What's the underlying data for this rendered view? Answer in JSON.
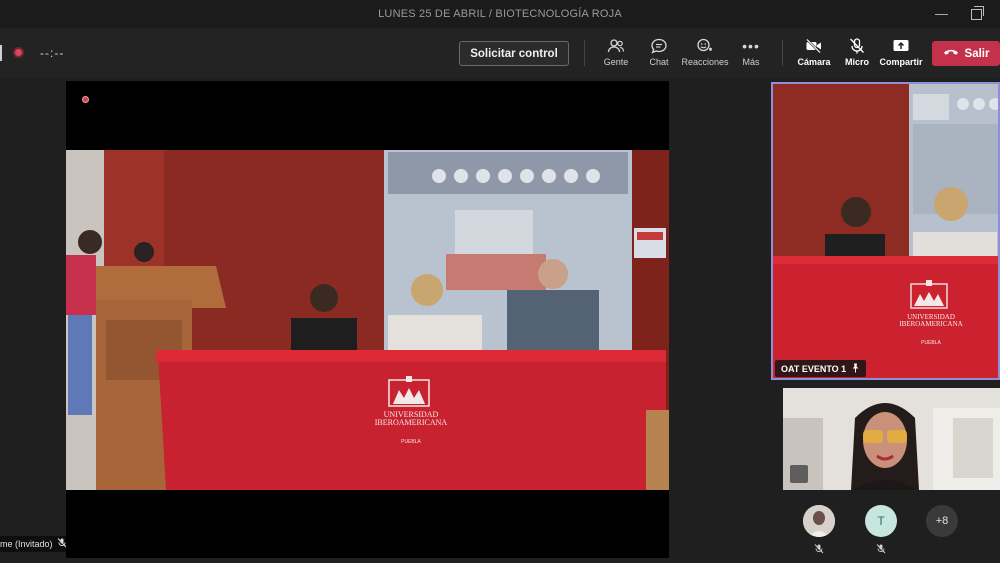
{
  "window": {
    "title": "LUNES 25 DE ABRIL / BIOTECNOLOGÍA ROJA"
  },
  "toolbar": {
    "timer": "--:--",
    "request_control": "Solicitar control",
    "people_label": "Gente",
    "chat_label": "Chat",
    "reactions_label": "Reacciones",
    "more_label": "Más",
    "camera_label": "Cámara",
    "mic_label": "Micro",
    "share_label": "Compartir",
    "leave_label": "Salir"
  },
  "stage": {
    "speaker_name_tag": "me (Invitado)",
    "banner_text": "UNIVERSIDAD IBEROAMERICANA",
    "banner_city": "PUEBLA"
  },
  "side_panel": {
    "room_label": "OAT EVENTO 1",
    "room_banner_text": "UNIVERSIDAD IBEROAMERICANA",
    "room_banner_city": "PUEBLA",
    "participants": [
      {
        "initial": "",
        "type": "photo"
      },
      {
        "initial": "T",
        "type": "initial"
      }
    ],
    "overflow_count": "+8"
  },
  "colors": {
    "accent_leave": "#c4314b",
    "active_tile_border": "#8e8fd6",
    "record_dot": "#e0435a"
  },
  "icons": [
    "people-icon",
    "chat-icon",
    "reactions-icon",
    "more-icon",
    "camera-off-icon",
    "mic-off-icon",
    "share-icon",
    "phone-hangup-icon",
    "pin-icon",
    "mic-muted-icon"
  ]
}
